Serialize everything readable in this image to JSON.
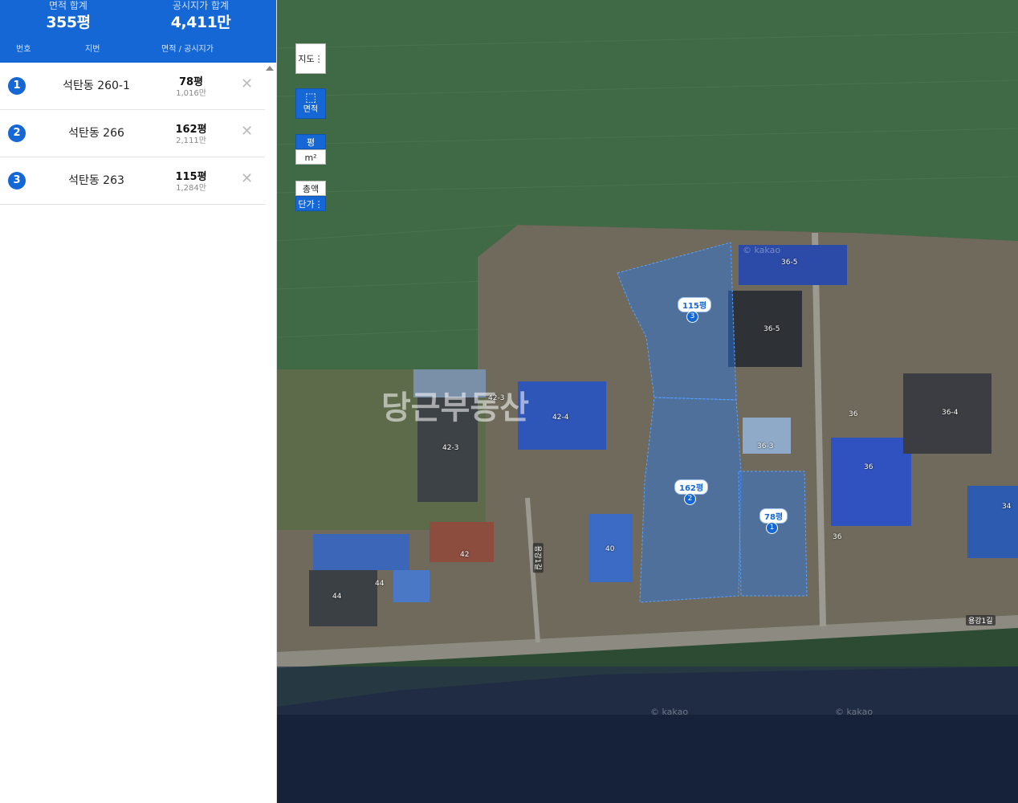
{
  "summary": {
    "area_label": "면적 합계",
    "area_value": "355평",
    "price_label": "공시지가 합계",
    "price_value": "4,411만",
    "col_number": "번호",
    "col_lot": "지번",
    "col_area_price": "면적 / 공시지가"
  },
  "parcels": [
    {
      "num": "1",
      "lot": "석탄동 260-1",
      "area": "78평",
      "price": "1,016만"
    },
    {
      "num": "2",
      "lot": "석탄동 266",
      "area": "162평",
      "price": "2,111만"
    },
    {
      "num": "3",
      "lot": "석탄동 263",
      "area": "115평",
      "price": "1,284만"
    }
  ],
  "controls": {
    "map_type": "지도",
    "area_tool": "면적",
    "unit_pyeong": "평",
    "unit_m2": "m²",
    "total": "총액",
    "unit_price": "단가"
  },
  "map": {
    "watermark": "당근부동산",
    "road_name": "용강1길",
    "road_name_2": "용강1길",
    "kakao": "© kakao",
    "plot_tags": [
      {
        "label": "115평",
        "num": "3"
      },
      {
        "label": "162평",
        "num": "2"
      },
      {
        "label": "78평",
        "num": "1"
      }
    ],
    "building_labels": [
      "36-5",
      "36-5",
      "42-3",
      "42-4",
      "42-3",
      "36-3",
      "36",
      "36-4",
      "36",
      "34",
      "36",
      "40",
      "42",
      "44",
      "44"
    ]
  },
  "icons": {
    "delete": "close-icon",
    "area": "square-select-icon"
  },
  "colors": {
    "accent": "#1467d4",
    "parcel_fill": "rgba(40,120,230,0.45)"
  }
}
